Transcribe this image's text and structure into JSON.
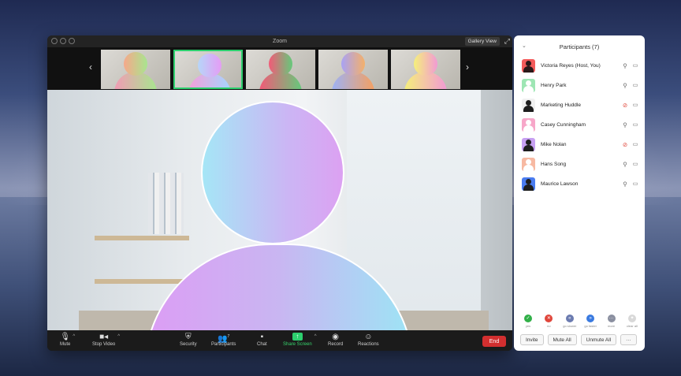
{
  "window": {
    "title": "Zoom",
    "gallery_view_label": "Gallery View",
    "expand_icon": "expand-icon"
  },
  "thumbnails": [
    {
      "head": "linear-gradient(90deg,#f6a88a,#a8e58f)",
      "body": "linear-gradient(90deg,#f29bb5,#a8e58f)",
      "active": false
    },
    {
      "head": "linear-gradient(90deg,#b6d6f8,#e59cf5)",
      "body": "linear-gradient(90deg,#f49fd9,#a5d5ff)",
      "active": true
    },
    {
      "head": "linear-gradient(90deg,#f25a78,#65c97b)",
      "body": "linear-gradient(90deg,#f25a78,#65c97b)",
      "active": false
    },
    {
      "head": "linear-gradient(90deg,#a8a2f5,#f4b06a)",
      "body": "linear-gradient(90deg,#9db2f5,#f4a062)",
      "active": false
    },
    {
      "head": "linear-gradient(90deg,#f5f07a,#f29ad4)",
      "body": "linear-gradient(90deg,#f5f07a,#f29ad4)",
      "active": false
    }
  ],
  "toolbar": {
    "mute": "Mute",
    "stop_video": "Stop Video",
    "security": "Security",
    "participants": "Participants",
    "participants_count": "7",
    "chat": "Chat",
    "share_screen": "Share Screen",
    "record": "Record",
    "reactions": "Reactions",
    "end": "End"
  },
  "panel": {
    "title": "Participants (7)",
    "participants": [
      {
        "name": "Victoria Reyes (Host, You)",
        "muted": false,
        "bg": "#f35b5b",
        "head": "#2b1a1a",
        "body": "#2b1a1a"
      },
      {
        "name": "Henry Park",
        "muted": false,
        "bg": "#9ee6b4",
        "head": "#ffffff",
        "body": "#ffffff"
      },
      {
        "name": "Marketing Huddle",
        "muted": true,
        "bg": "#f1f1f1",
        "head": "#1e1e1e",
        "body": "#1e1e1e"
      },
      {
        "name": "Casey Cunningham",
        "muted": false,
        "bg": "#f7a7c9",
        "head": "#ffffff",
        "body": "#ffffff"
      },
      {
        "name": "Mike Nolan",
        "muted": true,
        "bg": "#c7a0f2",
        "head": "#1e1e1e",
        "body": "#1e1e1e"
      },
      {
        "name": "Hans Song",
        "muted": false,
        "bg": "#f7b9a2",
        "head": "#ffffff",
        "body": "#ffffff"
      },
      {
        "name": "Maurice Lawson",
        "muted": false,
        "bg": "#4a7cf0",
        "head": "#1e1e1e",
        "body": "#1e1e1e"
      }
    ],
    "feedback": [
      {
        "label": "yes",
        "glyph": "✓",
        "color": "#31b048"
      },
      {
        "label": "no",
        "glyph": "✕",
        "color": "#e0463b"
      },
      {
        "label": "go slower",
        "glyph": "«",
        "color": "#6b7bb0"
      },
      {
        "label": "go faster",
        "glyph": "»",
        "color": "#3a7ae0"
      },
      {
        "label": "more",
        "glyph": "···",
        "color": "#8a8fa0"
      },
      {
        "label": "clear all",
        "glyph": "✦",
        "color": "#d8d8d8"
      }
    ],
    "invite": "Invite",
    "mute_all": "Mute All",
    "unmute_all": "Unmute All",
    "more": "···"
  }
}
